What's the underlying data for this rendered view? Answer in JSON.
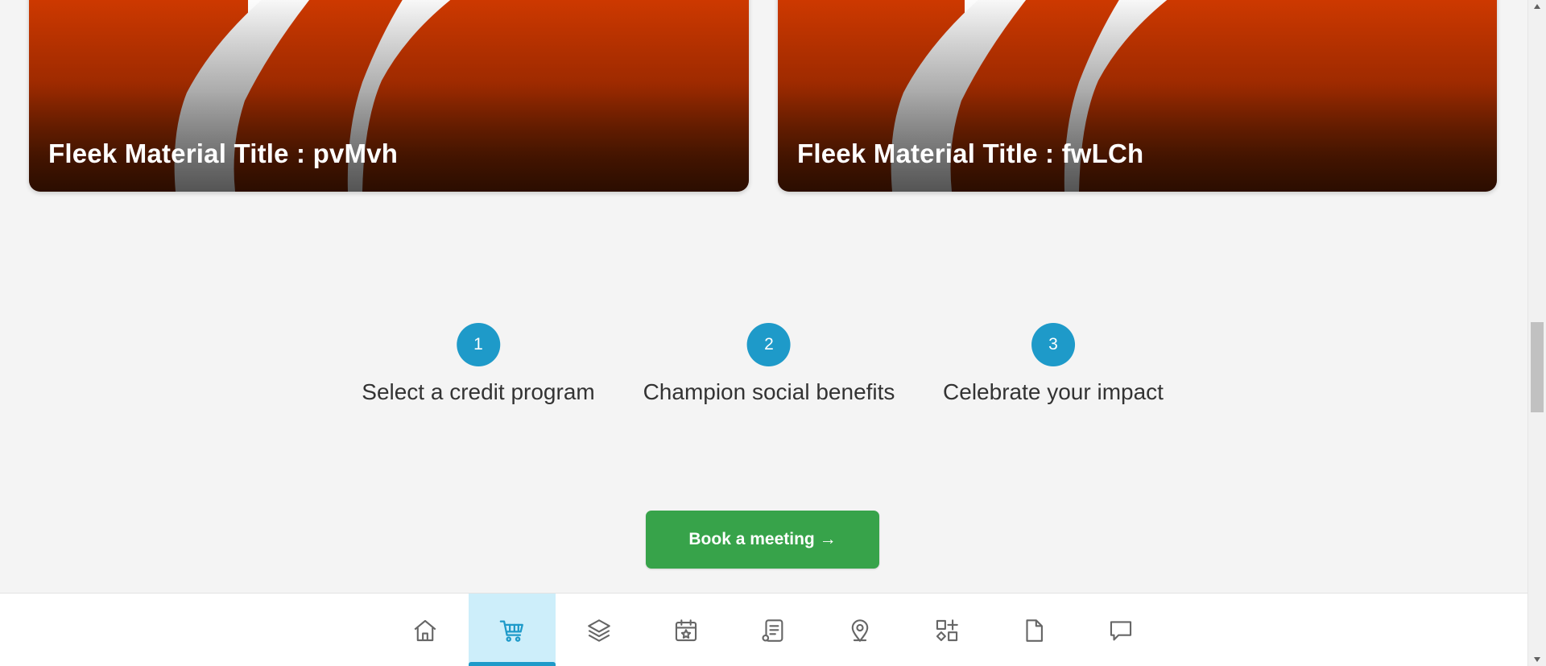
{
  "materials": [
    {
      "title": "Fleek Material Title : pvMvh"
    },
    {
      "title": "Fleek Material Title : fwLCh"
    }
  ],
  "steps": [
    {
      "number": "1",
      "label": "Select a credit program"
    },
    {
      "number": "2",
      "label": "Champion social benefits"
    },
    {
      "number": "3",
      "label": "Celebrate your impact"
    }
  ],
  "cta": {
    "label": "Book a meeting →"
  },
  "bottom_nav": {
    "active": "cart",
    "items": [
      "home",
      "cart",
      "layers",
      "events",
      "docs-list",
      "location",
      "apps",
      "file",
      "chat"
    ]
  },
  "colors": {
    "accent": "#1e9ac9",
    "cta": "#37a34a",
    "card_top": "#d23a00",
    "card_bottom": "#4e1800",
    "active_tab_bg": "#cdeefa",
    "background": "#f4f4f4"
  }
}
